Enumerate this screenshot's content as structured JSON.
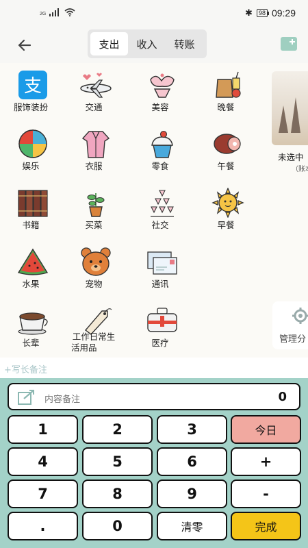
{
  "status_bar": {
    "signal_tag": "2G",
    "battery": "98",
    "time": "09:29"
  },
  "header": {
    "tabs": [
      {
        "label": "支出",
        "active": true
      },
      {
        "label": "收入",
        "active": false
      },
      {
        "label": "转账",
        "active": false
      }
    ]
  },
  "categories": [
    {
      "label": "服饰装扮",
      "icon": "alipay-icon"
    },
    {
      "label": "交通",
      "icon": "airplane-icon"
    },
    {
      "label": "美容",
      "icon": "lingerie-icon"
    },
    {
      "label": "晚餐",
      "icon": "dinner-bag-icon"
    },
    {
      "label": "娱乐",
      "icon": "beach-ball-icon"
    },
    {
      "label": "衣服",
      "icon": "robe-icon"
    },
    {
      "label": "零食",
      "icon": "cupcake-icon"
    },
    {
      "label": "午餐",
      "icon": "ham-icon"
    },
    {
      "label": "书籍",
      "icon": "books-icon"
    },
    {
      "label": "买菜",
      "icon": "plant-pot-icon"
    },
    {
      "label": "社交",
      "icon": "wine-tower-icon"
    },
    {
      "label": "早餐",
      "icon": "sun-icon"
    },
    {
      "label": "水果",
      "icon": "watermelon-icon"
    },
    {
      "label": "宠物",
      "icon": "bear-icon"
    },
    {
      "label": "通讯",
      "icon": "envelope-icon"
    },
    {
      "label": "长辈",
      "icon": "coffee-cup-icon"
    },
    {
      "label": "工作日常生活用品",
      "label_lines": [
        "工作日常生",
        "活用品"
      ],
      "icon": "price-tag-icon"
    },
    {
      "label": "医疗",
      "icon": "medical-case-icon"
    }
  ],
  "side_panel": {
    "label": "未选中",
    "sub_label": "（账本",
    "manage_label": "管理分"
  },
  "note": {
    "long_note_link": "+写长备注"
  },
  "keypad": {
    "memo_placeholder": "内容备注",
    "amount": "0",
    "keys": [
      "1",
      "2",
      "3",
      "今日",
      "4",
      "5",
      "6",
      "+",
      "7",
      "8",
      "9",
      "-",
      ".",
      "0",
      "清零",
      "完成"
    ]
  },
  "colors": {
    "keypad_bg": "#a3d2c8",
    "today_key": "#f1a9a0",
    "done_key": "#f4c518",
    "accent": "#9fcfc0"
  }
}
